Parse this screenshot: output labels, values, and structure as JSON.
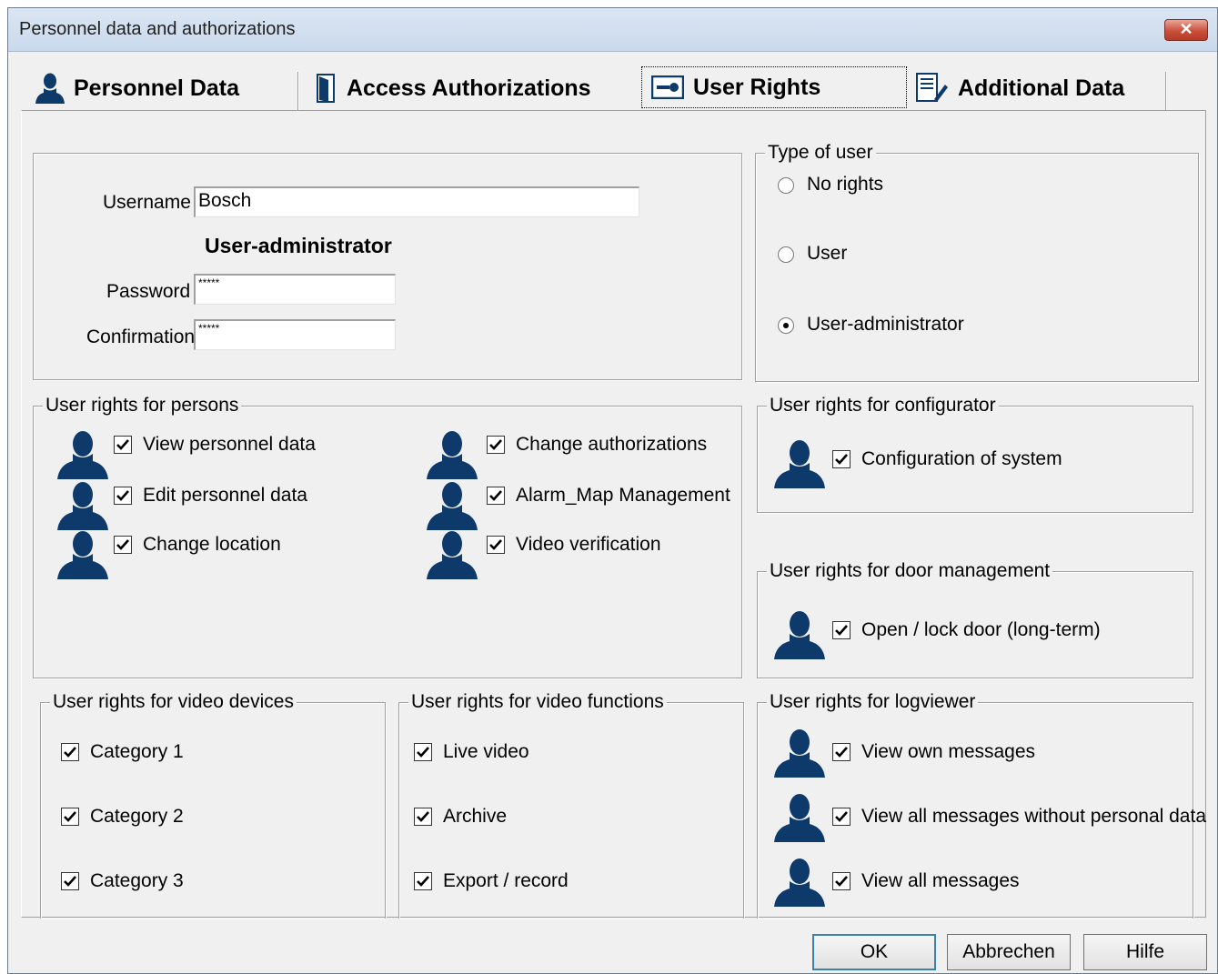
{
  "window": {
    "title": "Personnel data and authorizations",
    "close_symbol": "✕"
  },
  "tabs": [
    {
      "label": "Personnel Data",
      "icon": "person-icon",
      "active": false
    },
    {
      "label": "Access Authorizations",
      "icon": "door-icon",
      "active": false
    },
    {
      "label": "User Rights",
      "icon": "key-card-icon",
      "active": true
    },
    {
      "label": "Additional Data",
      "icon": "document-icon",
      "active": false
    }
  ],
  "account": {
    "username_label": "Username",
    "username_value": "Bosch",
    "role_heading": "User-administrator",
    "password_label": "Password",
    "password_value": "*****",
    "confirmation_label": "Confirmation",
    "confirmation_value": "*****"
  },
  "type_of_user": {
    "legend": "Type of user",
    "options": [
      {
        "label": "No rights",
        "selected": false
      },
      {
        "label": "User",
        "selected": false
      },
      {
        "label": "User-administrator",
        "selected": true
      }
    ]
  },
  "persons_rights": {
    "legend": "User rights for persons",
    "items": [
      {
        "label": "View personnel data",
        "checked": true
      },
      {
        "label": "Edit personnel data",
        "checked": true
      },
      {
        "label": "Change location",
        "checked": true
      },
      {
        "label": "Change authorizations",
        "checked": true
      },
      {
        "label": "Alarm_Map Management",
        "checked": true
      },
      {
        "label": "Video verification",
        "checked": true
      }
    ]
  },
  "configurator_rights": {
    "legend": "User rights for configurator",
    "items": [
      {
        "label": "Configuration of system",
        "checked": true
      }
    ]
  },
  "door_rights": {
    "legend": "User rights for door management",
    "items": [
      {
        "label": "Open / lock door (long-term)",
        "checked": true
      }
    ]
  },
  "video_devices": {
    "legend": "User rights for video devices",
    "items": [
      {
        "label": "Category 1",
        "checked": true
      },
      {
        "label": "Category 2",
        "checked": true
      },
      {
        "label": "Category 3",
        "checked": true
      }
    ]
  },
  "video_functions": {
    "legend": "User rights for video functions",
    "items": [
      {
        "label": "Live video",
        "checked": true
      },
      {
        "label": "Archive",
        "checked": true
      },
      {
        "label": "Export / record",
        "checked": true
      }
    ]
  },
  "logviewer": {
    "legend": "User rights for logviewer",
    "items": [
      {
        "label": "View own messages",
        "checked": true
      },
      {
        "label": "View all messages without personal data",
        "checked": true
      },
      {
        "label": "View all messages",
        "checked": true
      }
    ]
  },
  "buttons": {
    "ok": "OK",
    "cancel": "Abbrechen",
    "help": "Hilfe"
  },
  "colors": {
    "icon_blue": "#0d3a6b",
    "titlebar": "#c9d9ec",
    "close_red": "#c9503b"
  }
}
